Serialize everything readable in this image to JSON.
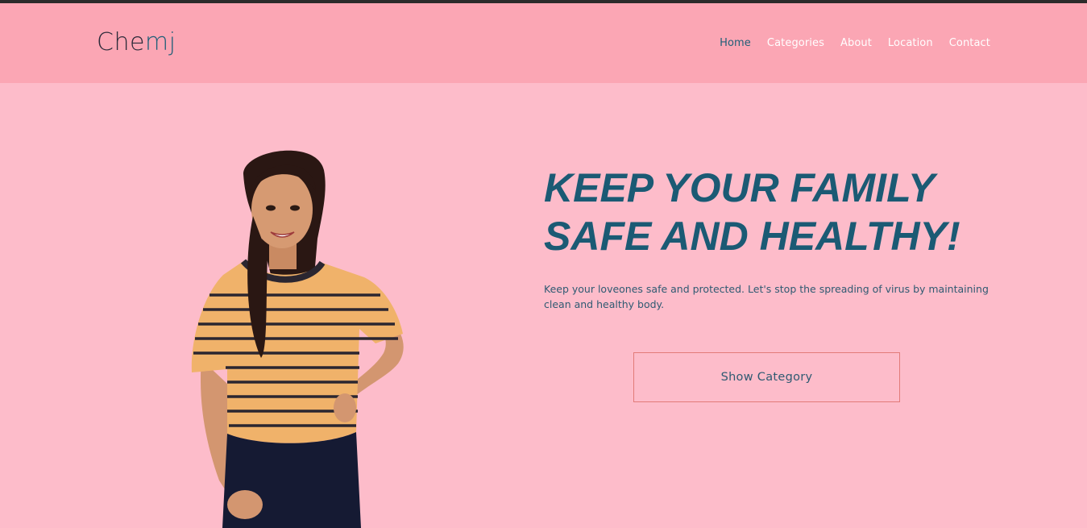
{
  "brand": {
    "part1": "Che",
    "part2": "mj"
  },
  "nav": {
    "items": [
      {
        "label": "Home"
      },
      {
        "label": "Categories"
      },
      {
        "label": "About"
      },
      {
        "label": "Location"
      },
      {
        "label": "Contact"
      }
    ]
  },
  "hero": {
    "headline_line1": "KEEP YOUR FAMILY",
    "headline_line2": "SAFE AND HEALTHY!",
    "description": "Keep your loveones safe and protected. Let's stop the spreading of virus by maintaining clean and healthy body.",
    "cta_label": "Show Category"
  },
  "colors": {
    "page_bg": "#fdbcca",
    "header_bg": "#fba6b4",
    "accent": "#1b5a74",
    "button_border": "#e27b79"
  }
}
